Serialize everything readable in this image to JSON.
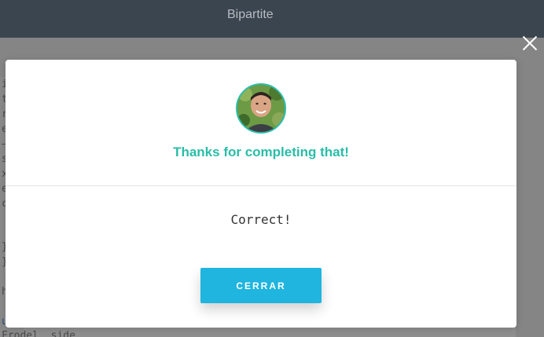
{
  "app": {
    "title": "Bipartite"
  },
  "background_code": {
    "lines": [
      "i",
      "t",
      "r",
      "e",
      "–",
      "s",
      "x",
      "e",
      "c",
      "}",
      "}",
      "h",
      "u",
      "Frodel  side"
    ]
  },
  "modal": {
    "title": "Thanks for completing that!",
    "result": "Correct!",
    "button_label": "CERRAR"
  },
  "colors": {
    "accent_teal": "#29bda9",
    "button_blue": "#1fb5df",
    "topbar": "#3b4550"
  },
  "icons": {
    "close": "close-icon",
    "avatar": "user-avatar"
  }
}
